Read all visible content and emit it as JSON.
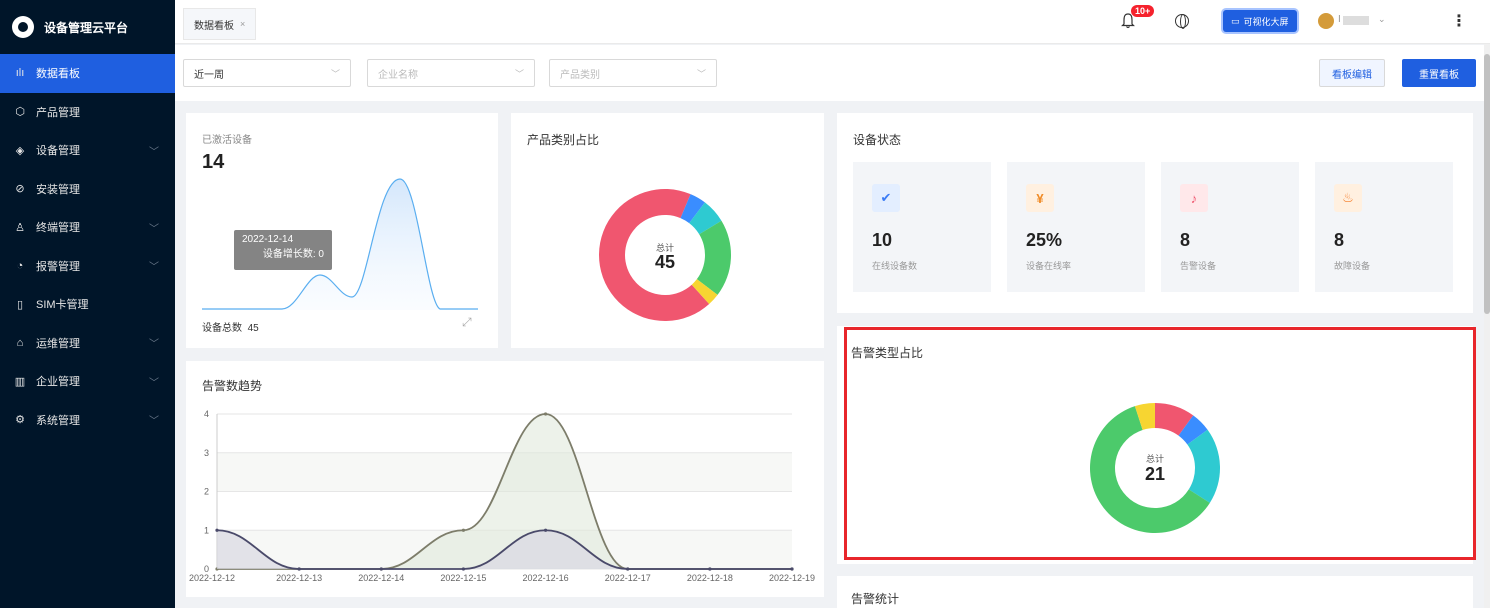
{
  "app": {
    "title": "设备管理云平台"
  },
  "sidebar": {
    "items": [
      {
        "label": "数据看板",
        "icon": "bar-chart-icon",
        "active": true
      },
      {
        "label": "产品管理",
        "icon": "box-icon"
      },
      {
        "label": "设备管理",
        "icon": "layers-icon",
        "expandable": true
      },
      {
        "label": "安装管理",
        "icon": "compass-icon"
      },
      {
        "label": "终端管理",
        "icon": "user-icon",
        "expandable": true
      },
      {
        "label": "报警管理",
        "icon": "alarm-icon",
        "expandable": true
      },
      {
        "label": "SIM卡管理",
        "icon": "sim-card-icon"
      },
      {
        "label": "运维管理",
        "icon": "tool-icon",
        "expandable": true
      },
      {
        "label": "企业管理",
        "icon": "building-icon",
        "expandable": true
      },
      {
        "label": "系统管理",
        "icon": "gear-icon",
        "expandable": true
      }
    ]
  },
  "header": {
    "tab_label": "数据看板",
    "tab_close": "×",
    "notification_badge": "10+",
    "screen_button": "可视化大屏",
    "user_initial": "I"
  },
  "filters": {
    "period": "近一周",
    "company_placeholder": "企业名称",
    "product_placeholder": "产品类别",
    "edit_button": "看板编辑",
    "reset_button": "重置看板"
  },
  "activated": {
    "label": "已激活设备",
    "value": "14",
    "tooltip_date": "2022-12-14",
    "tooltip_text": "设备增长数: 0",
    "total_label": "设备总数",
    "total_value": "45"
  },
  "product_share": {
    "title": "产品类别占比",
    "total_label": "总计",
    "total_value": "45",
    "segments": [
      {
        "value": 0.68,
        "color": "#f0566f"
      },
      {
        "value": 0.04,
        "color": "#3a8dff"
      },
      {
        "value": 0.06,
        "color": "#2ecad1"
      },
      {
        "value": 0.19,
        "color": "#4cca6b"
      },
      {
        "value": 0.03,
        "color": "#f7d531"
      }
    ]
  },
  "device_status": {
    "title": "设备状态",
    "items": [
      {
        "value": "10",
        "label": "在线设备数",
        "icon": "verified-icon",
        "bg": "#e3eeff",
        "fg": "#3a7bf5"
      },
      {
        "value": "25%",
        "label": "设备在线率",
        "icon": "money-bag-icon",
        "bg": "#fff0e0",
        "fg": "#f08a24"
      },
      {
        "value": "8",
        "label": "告警设备",
        "icon": "bell-alert-icon",
        "bg": "#ffe8ea",
        "fg": "#f0566f"
      },
      {
        "value": "8",
        "label": "故障设备",
        "icon": "fire-icon",
        "bg": "#fff0e0",
        "fg": "#f57a24"
      }
    ]
  },
  "alarm_share": {
    "title": "告警类型占比",
    "total_label": "总计",
    "total_value": "21",
    "segments": [
      {
        "value": 0.1,
        "color": "#f0566f"
      },
      {
        "value": 0.05,
        "color": "#3a8dff"
      },
      {
        "value": 0.19,
        "color": "#2ecad1"
      },
      {
        "value": 0.61,
        "color": "#4cca6b"
      },
      {
        "value": 0.05,
        "color": "#f7d531"
      }
    ]
  },
  "alarm_trend": {
    "title": "告警数趋势"
  },
  "alarm_stats": {
    "title": "告警统计"
  },
  "chart_data": [
    {
      "type": "area",
      "title": "告警数趋势",
      "categories": [
        "2022-12-12",
        "2022-12-13",
        "2022-12-14",
        "2022-12-15",
        "2022-12-16",
        "2022-12-17",
        "2022-12-18",
        "2022-12-19"
      ],
      "ylim": [
        0,
        4
      ],
      "yticks": [
        "0",
        "1",
        "2",
        "3",
        "4"
      ],
      "series": [
        {
          "values": [
            0,
            0,
            0,
            1,
            4,
            0,
            0,
            0
          ],
          "color": "#7d7d6a"
        },
        {
          "values": [
            1,
            0,
            0,
            0,
            1,
            0,
            0,
            0
          ],
          "color": "#4a4a6a"
        }
      ]
    }
  ]
}
